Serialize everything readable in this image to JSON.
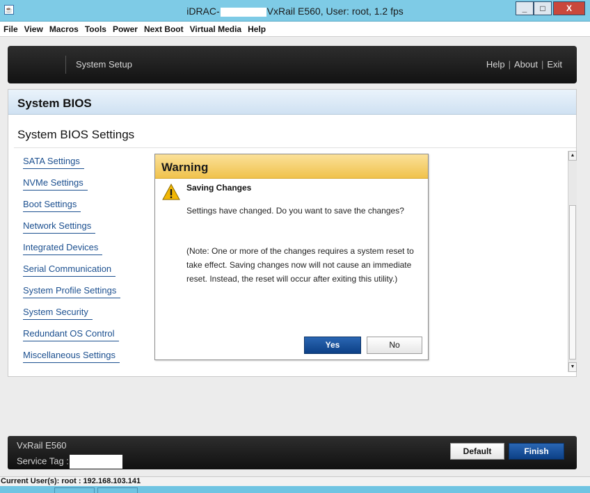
{
  "window": {
    "title_prefix": "iDRAC-",
    "title_suffix": "VxRail E560, User: root, 1.2 fps",
    "minimize": "_",
    "maximize": "□",
    "close": "X"
  },
  "menubar": {
    "items": [
      "File",
      "View",
      "Macros",
      "Tools",
      "Power",
      "Next Boot",
      "Virtual Media",
      "Help"
    ]
  },
  "header": {
    "title": "System Setup",
    "links": [
      "Help",
      "About",
      "Exit"
    ]
  },
  "panel": {
    "title": "System BIOS",
    "subtitle": "System BIOS Settings",
    "nav": [
      "SATA Settings",
      "NVMe Settings",
      "Boot Settings",
      "Network Settings",
      "Integrated Devices",
      "Serial Communication",
      "System Profile Settings",
      "System Security",
      "Redundant OS Control",
      "Miscellaneous Settings"
    ]
  },
  "dialog": {
    "title": "Warning",
    "heading": "Saving Changes",
    "message": "Settings have changed. Do you want to save the changes?",
    "note": "(Note: One or more of the changes requires a system reset to take effect. Saving changes now will not cause an immediate reset. Instead, the reset will occur after exiting this utility.)",
    "yes_label": "Yes",
    "no_label": "No"
  },
  "footer": {
    "model": "VxRail E560",
    "service_tag_label": "Service Tag :",
    "default_label": "Default",
    "finish_label": "Finish"
  },
  "status": {
    "text": "Current User(s): root : 192.168.103.141"
  },
  "colors": {
    "accent_blue": "#0c4086",
    "warning_header": "#f0c24c",
    "link_blue": "#1b4f8f",
    "window_frame": "#7ecbe6"
  }
}
